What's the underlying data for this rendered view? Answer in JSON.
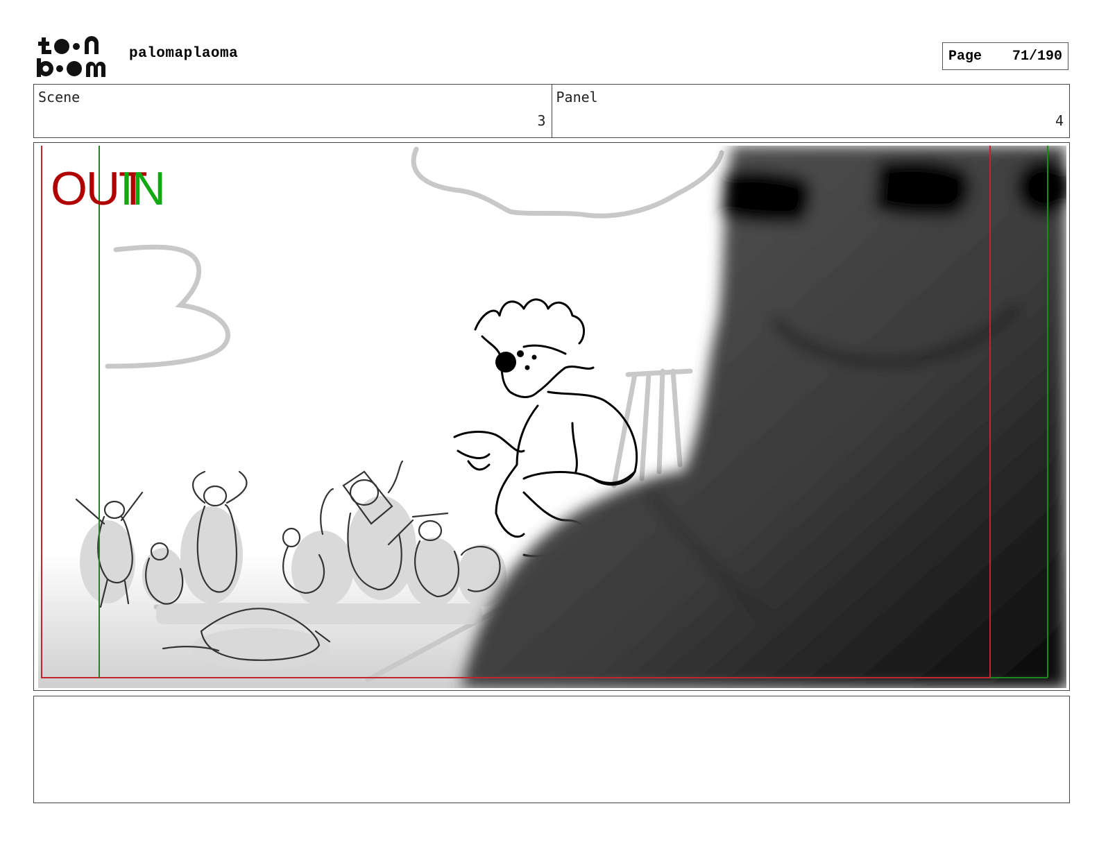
{
  "header": {
    "logo_text": "toon boom",
    "project_name": "palomaplaoma",
    "page_label": "Page",
    "page_number": "71/190"
  },
  "scene": {
    "label": "Scene",
    "value": "3"
  },
  "panel": {
    "label": "Panel",
    "value": "4"
  },
  "camera": {
    "out_label": "OUT",
    "in_label": "IN",
    "out_color": "#b00000",
    "in_color": "#13a813"
  },
  "notes": {
    "text": ""
  }
}
